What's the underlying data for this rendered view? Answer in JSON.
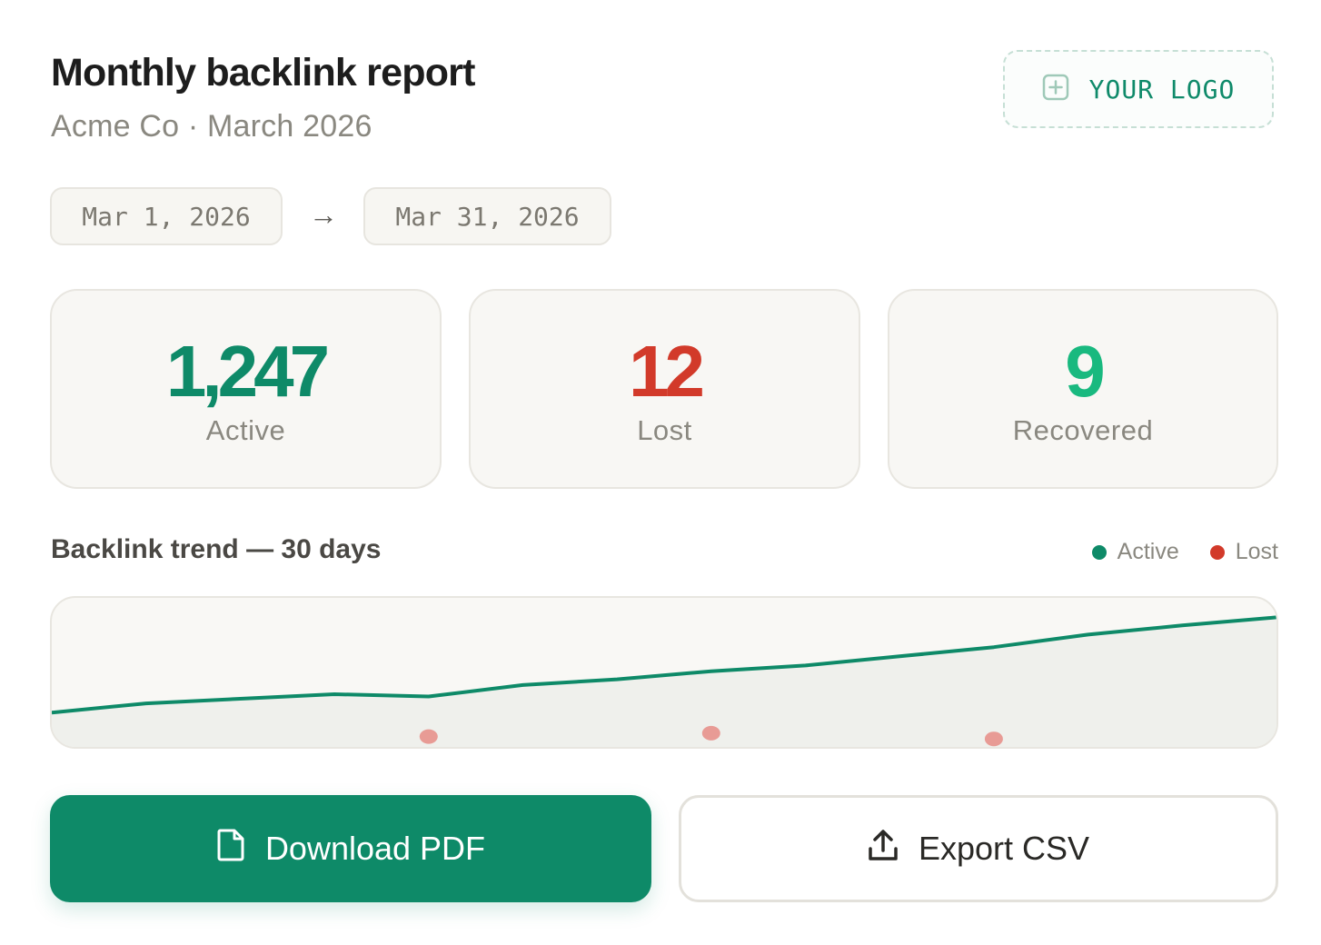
{
  "header": {
    "title": "Monthly backlink report",
    "subtitle": "Acme Co · March 2026",
    "logo_label": "YOUR LOGO"
  },
  "date_range": {
    "start": "Mar 1, 2026",
    "arrow": "→",
    "end": "Mar 31, 2026"
  },
  "stats": [
    {
      "value": "1,247",
      "label": "Active",
      "color": "#0e8a68"
    },
    {
      "value": "12",
      "label": "Lost",
      "color": "#d23a2a"
    },
    {
      "value": "9",
      "label": "Recovered",
      "color": "#19b97f"
    }
  ],
  "trend": {
    "title": "Backlink trend — 30 days",
    "legend": [
      {
        "label": "Active",
        "color": "#0e8a68"
      },
      {
        "label": "Lost",
        "color": "#d23a2a"
      }
    ]
  },
  "chart_data": {
    "type": "line",
    "x": [
      1,
      4,
      7,
      10,
      13,
      16,
      19,
      22,
      25,
      28,
      31,
      34,
      37,
      40
    ],
    "series": [
      {
        "name": "Active",
        "color": "#0e8a68",
        "values": [
          1100,
          1108,
          1112,
          1116,
          1114,
          1124,
          1129,
          1136,
          1141,
          1149,
          1157,
          1168,
          1176,
          1183
        ]
      },
      {
        "name": "Lost",
        "color": "#d23a2a",
        "points": [
          {
            "x": 13,
            "y": 1079
          },
          {
            "x": 22,
            "y": 1082
          },
          {
            "x": 31,
            "y": 1077
          }
        ]
      }
    ],
    "ylim": [
      1070,
      1200
    ],
    "xlim": [
      1,
      40
    ],
    "grid": false,
    "legend": "top-right"
  },
  "actions": {
    "download_label": "Download PDF",
    "export_label": "Export CSV"
  },
  "colors": {
    "accent": "#0e8a68",
    "lost": "#d23a2a",
    "recovered": "#19b97f",
    "lost_marker": "#e89b95"
  }
}
